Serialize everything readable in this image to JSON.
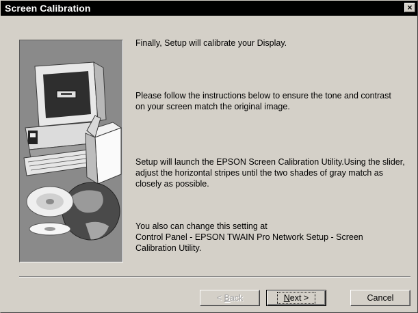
{
  "window": {
    "title": "Screen Calibration",
    "close_glyph": "×"
  },
  "content": {
    "para1": "Finally, Setup will calibrate your Display.",
    "para2": "Please follow the instructions below to ensure the tone and contrast on your screen match the original image.",
    "para3": "Setup will launch the EPSON Screen Calibration Utility.Using the slider, adjust the horizontal stripes until the two shades of gray match as closely as possible.",
    "para4_line1": "You also can change this setting at",
    "para4_line2": "Control Panel - EPSON TWAIN Pro Network Setup - Screen Calibration Utility."
  },
  "buttons": {
    "back_prefix": "< ",
    "back_hotkey": "B",
    "back_rest": "ack",
    "next_hotkey": "N",
    "next_rest": "ext >",
    "cancel": "Cancel"
  },
  "art": {
    "icons": [
      "computer-monitor-icon",
      "disc-icon",
      "globe-icon",
      "box-icon"
    ]
  }
}
